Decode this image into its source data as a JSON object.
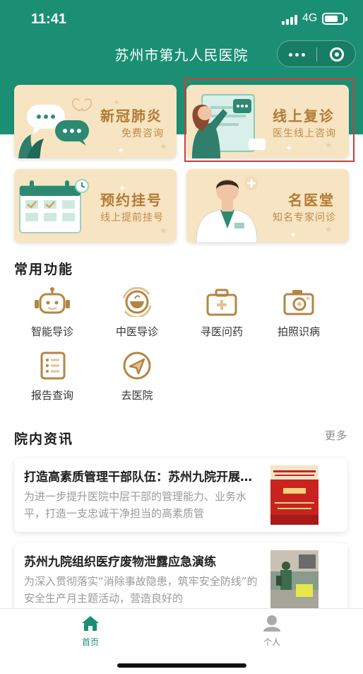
{
  "status_bar": {
    "time": "11:41",
    "network": "4G"
  },
  "nav": {
    "title": "苏州市第九人民医院"
  },
  "colors": {
    "brand": "#1b8f74",
    "card_bg": "#f7e4c2",
    "card_title": "#b27a33",
    "icon_gold": "#b58544",
    "highlight": "#d63a3a"
  },
  "cards": [
    {
      "title": "新冠肺炎",
      "subtitle": "免费咨询",
      "icon": "chat-bubbles-illustration"
    },
    {
      "title": "线上复诊",
      "subtitle": "医生线上咨询",
      "icon": "doctor-whiteboard-illustration"
    },
    {
      "title": "预约挂号",
      "subtitle": "线上提前挂号",
      "icon": "calendar-illustration"
    },
    {
      "title": "名医堂",
      "subtitle": "知名专家问诊",
      "icon": "doctor-illustration"
    }
  ],
  "functions": {
    "title": "常用功能",
    "items": [
      {
        "label": "智能导诊",
        "icon": "robot-icon"
      },
      {
        "label": "中医导诊",
        "icon": "herb-bowl-icon"
      },
      {
        "label": "寻医问药",
        "icon": "medical-kit-icon"
      },
      {
        "label": "拍照识病",
        "icon": "camera-icon"
      },
      {
        "label": "报告查询",
        "icon": "report-list-icon"
      },
      {
        "label": "去医院",
        "icon": "navigation-arrow-icon"
      }
    ]
  },
  "news": {
    "title": "院内资讯",
    "more": "更多",
    "items": [
      {
        "title": "打造高素质管理干部队伍：苏州九院开展中层干部管理素质提升培训班",
        "body": "为进一步提升医院中层干部的管理能力、业务水平，打造一支忠诚干净担当的高素质管"
      },
      {
        "title": "苏州九院组织医疗废物泄露应急演练",
        "body": "为深入贯彻落实“消除事故隐患，筑牢安全防线”的安全生产月主题活动，营造良好的"
      }
    ]
  },
  "tabbar": {
    "items": [
      {
        "label": "首页",
        "icon": "home-icon"
      },
      {
        "label": "个人",
        "icon": "user-icon"
      }
    ]
  }
}
